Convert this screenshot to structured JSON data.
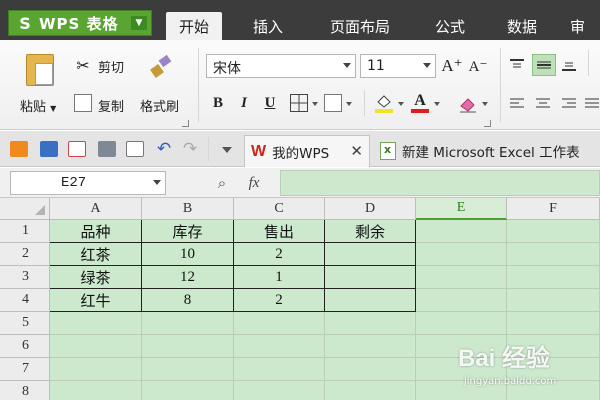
{
  "app": {
    "name": "WPS 表格",
    "logo_char": "S"
  },
  "menu_tabs": [
    "开始",
    "插入",
    "页面布局",
    "公式",
    "数据",
    "审"
  ],
  "ribbon": {
    "paste": "粘贴",
    "cut": "剪切",
    "copy": "复制",
    "format_painter": "格式刷",
    "font_name": "宋体",
    "font_size": "11",
    "bold": "B",
    "italic": "I",
    "underline": "U",
    "font_color_letter": "A",
    "grow_font": "A⁺",
    "shrink_font": "A⁻"
  },
  "doc_tabs": [
    {
      "label": "我的WPS",
      "close": "✕"
    },
    {
      "label": "新建 Microsoft Excel 工作表"
    }
  ],
  "formula_bar": {
    "cell_ref": "E27",
    "fx": "fx"
  },
  "sheet": {
    "columns": [
      "A",
      "B",
      "C",
      "D",
      "E",
      "F"
    ],
    "selected_column": "E",
    "row_numbers": [
      "1",
      "2",
      "3",
      "4",
      "5",
      "6",
      "7",
      "8"
    ],
    "rows": [
      [
        "品种",
        "库存",
        "售出",
        "剩余",
        "",
        ""
      ],
      [
        "红茶",
        "10",
        "2",
        "",
        "",
        ""
      ],
      [
        "绿茶",
        "12",
        "1",
        "",
        "",
        ""
      ],
      [
        "红牛",
        "8",
        "2",
        "",
        "",
        ""
      ],
      [
        "",
        "",
        "",
        "",
        "",
        ""
      ],
      [
        "",
        "",
        "",
        "",
        "",
        ""
      ],
      [
        "",
        "",
        "",
        "",
        "",
        ""
      ],
      [
        "",
        "",
        "",
        "",
        "",
        ""
      ]
    ]
  },
  "watermark": {
    "text": "Bai 经验",
    "url": "jingyan.baidu.com"
  },
  "colors": {
    "accent": "#5aa532",
    "sheet_fill": "#cce8cd",
    "menubar": "#3c3c3c"
  }
}
